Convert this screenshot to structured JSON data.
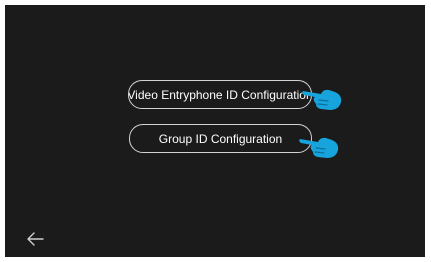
{
  "menu": {
    "video_entryphone_label": "Video Entryphone ID Configuration",
    "group_id_label": "Group ID Configuration"
  },
  "icons": {
    "pointer": "hand-pointer-icon",
    "back": "back-arrow-icon"
  },
  "colors": {
    "screen_bg": "#1b1b1b",
    "button_border": "#d4d4d4",
    "button_text": "#ffffff",
    "hand_accent": "#17a3dc"
  }
}
